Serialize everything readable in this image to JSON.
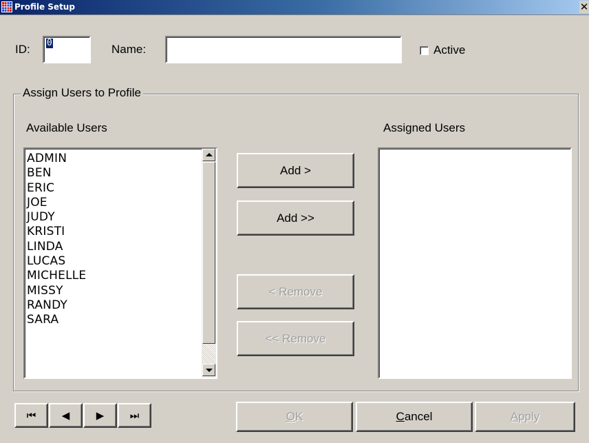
{
  "window": {
    "title": "Profile Setup",
    "close_glyph": "✕"
  },
  "form": {
    "id_label": "ID:",
    "id_value": "0",
    "name_label": "Name:",
    "name_value": "",
    "active_label": "Active",
    "active_checked": false
  },
  "assign_group": {
    "title": "Assign Users to Profile",
    "available_label": "Available Users",
    "assigned_label": "Assigned Users",
    "available_users": [
      "ADMIN",
      "BEN",
      "ERIC",
      "JOE",
      "JUDY",
      "KRISTI",
      "LINDA",
      "LUCAS",
      "MICHELLE",
      "MISSY",
      "RANDY",
      "SARA"
    ],
    "assigned_users": []
  },
  "transfer_buttons": {
    "add": "Add >",
    "add_all": "Add >>",
    "remove": "< Remove",
    "remove_all": "<< Remove"
  },
  "nav_buttons": {
    "first": "⏮",
    "prev": "◀",
    "next": "▶",
    "last": "⏭"
  },
  "dialog_buttons": {
    "ok_mnemonic": "O",
    "ok_rest": "K",
    "cancel_mnemonic": "C",
    "cancel_rest": "ancel",
    "apply_mnemonic": "A",
    "apply_rest": "pply"
  },
  "colors": {
    "face": "#d4d0c8",
    "title_start": "#0a246a",
    "title_end": "#a6caf0",
    "disabled_text": "#a0a0a0"
  }
}
